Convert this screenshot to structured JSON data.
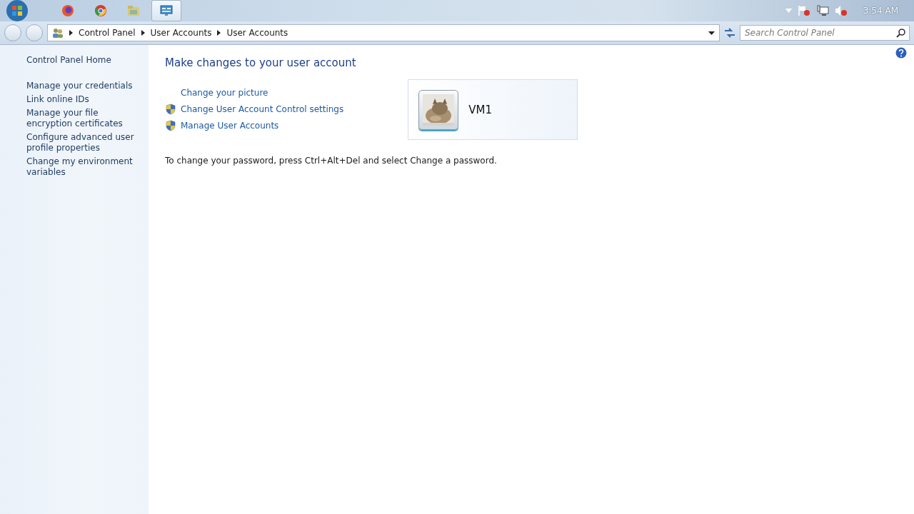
{
  "taskbar": {
    "apps": [
      {
        "selected": false
      },
      {
        "selected": false
      },
      {
        "selected": false
      },
      {
        "selected": true
      }
    ],
    "clock": "3:54 AM"
  },
  "address_bar": {
    "breadcrumbs": [
      "Control Panel",
      "User Accounts",
      "User Accounts"
    ],
    "search": {
      "placeholder": "Search Control Panel"
    }
  },
  "sidebar": {
    "home": "Control Panel Home",
    "items": [
      "Manage your credentials",
      "Link online IDs",
      "Manage your file encryption certificates",
      "Configure advanced user profile properties",
      "Change my environment variables"
    ]
  },
  "main": {
    "title": "Make changes to your user account",
    "tasks": [
      {
        "label": "Change your picture",
        "kind": "plain"
      },
      {
        "label": "Change User Account Control settings",
        "kind": "shield"
      },
      {
        "label": "Manage User Accounts",
        "kind": "shield"
      }
    ],
    "account": {
      "name": "VM1"
    },
    "note": "To change your password, press Ctrl+Alt+Del and select Change a password."
  }
}
